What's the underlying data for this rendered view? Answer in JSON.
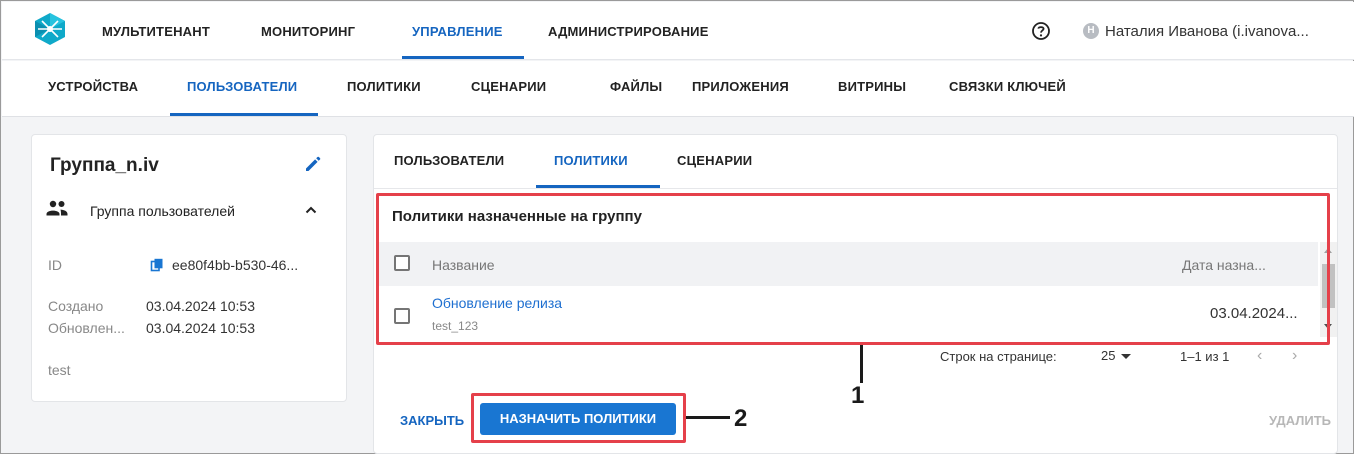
{
  "topbar": {
    "nav": [
      {
        "label": "МУЛЬТИТЕНАНТ"
      },
      {
        "label": "МОНИТОРИНГ"
      },
      {
        "label": "УПРАВЛЕНИЕ",
        "active": true
      },
      {
        "label": "АДМИНИСТРИРОВАНИЕ"
      }
    ],
    "avatar_letter": "Н",
    "user_name": "Наталия Иванова (i.ivanova..."
  },
  "subnav": {
    "items": [
      {
        "label": "УСТРОЙСТВА"
      },
      {
        "label": "ПОЛЬЗОВАТЕЛИ",
        "active": true
      },
      {
        "label": "ПОЛИТИКИ"
      },
      {
        "label": "СЦЕНАРИИ"
      },
      {
        "label": "ФАЙЛЫ"
      },
      {
        "label": "ПРИЛОЖЕНИЯ"
      },
      {
        "label": "ВИТРИНЫ"
      },
      {
        "label": "СВЯЗКИ КЛЮЧЕЙ"
      }
    ]
  },
  "group": {
    "title": "Группа_n.iv",
    "type": "Группа пользователей",
    "id_label": "ID",
    "id_value": "ee80f4bb-b530-46...",
    "created_label": "Создано",
    "created_value": "03.04.2024 10:53",
    "updated_label": "Обновлен...",
    "updated_value": "03.04.2024 10:53",
    "description": "test"
  },
  "detail": {
    "tabs": [
      {
        "label": "ПОЛЬЗОВАТЕЛИ"
      },
      {
        "label": "ПОЛИТИКИ",
        "active": true
      },
      {
        "label": "СЦЕНАРИИ"
      }
    ],
    "section_title": "Политики назначенные на группу",
    "table": {
      "columns": [
        "Название",
        "Дата назна..."
      ],
      "rows": [
        {
          "name": "Обновление релиза",
          "sub": "test_123",
          "date": "03.04.2024..."
        }
      ]
    },
    "pager": {
      "rows_label": "Строк на странице:",
      "rows_value": "25",
      "range": "1–1 из 1",
      "prev": "‹",
      "next": "›"
    },
    "buttons": {
      "close": "ЗАКРЫТЬ",
      "assign": "НАЗНАЧИТЬ ПОЛИТИКИ",
      "delete": "УДАЛИТЬ"
    }
  },
  "annotations": {
    "label_1": "1",
    "label_2": "2",
    "color": "#e5404a"
  },
  "colors": {
    "accent": "#1565c0",
    "primary_button": "#1976d2",
    "link": "#1e6fd0"
  }
}
